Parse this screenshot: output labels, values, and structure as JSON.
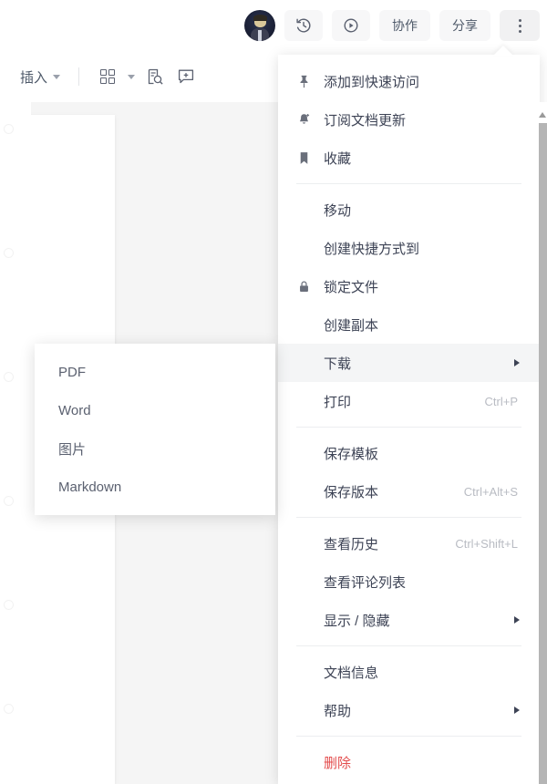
{
  "topbar": {
    "avatar_name": "user-avatar",
    "buttons": [
      {
        "name": "history-icon",
        "label": "",
        "type": "icon"
      },
      {
        "name": "play-icon",
        "label": "",
        "type": "icon"
      },
      {
        "name": "collaborate",
        "label": "协作",
        "type": "text"
      },
      {
        "name": "share",
        "label": "分享",
        "type": "text"
      },
      {
        "name": "more-options",
        "label": "",
        "type": "dots"
      }
    ]
  },
  "toolbar": {
    "insert_label": "插入",
    "grid_name": "grid-icon",
    "find_name": "find-replace-icon",
    "comment_name": "add-comment-icon"
  },
  "menu": {
    "items": [
      {
        "type": "item",
        "icon": "pin-icon",
        "label": "添加到快速访问",
        "shortcut": "",
        "arrow": false,
        "active": false,
        "danger": false
      },
      {
        "type": "item",
        "icon": "bell-add-icon",
        "label": "订阅文档更新",
        "shortcut": "",
        "arrow": false,
        "active": false,
        "danger": false
      },
      {
        "type": "item",
        "icon": "bookmark-icon",
        "label": "收藏",
        "shortcut": "",
        "arrow": false,
        "active": false,
        "danger": false
      },
      {
        "type": "sep"
      },
      {
        "type": "item",
        "icon": "",
        "label": "移动",
        "shortcut": "",
        "arrow": false,
        "active": false,
        "danger": false
      },
      {
        "type": "item",
        "icon": "",
        "label": "创建快捷方式到",
        "shortcut": "",
        "arrow": false,
        "active": false,
        "danger": false
      },
      {
        "type": "item",
        "icon": "lock-icon",
        "label": "锁定文件",
        "shortcut": "",
        "arrow": false,
        "active": false,
        "danger": false
      },
      {
        "type": "item",
        "icon": "",
        "label": "创建副本",
        "shortcut": "",
        "arrow": false,
        "active": false,
        "danger": false
      },
      {
        "type": "item",
        "icon": "",
        "label": "下载",
        "shortcut": "",
        "arrow": true,
        "active": true,
        "danger": false
      },
      {
        "type": "item",
        "icon": "",
        "label": "打印",
        "shortcut": "Ctrl+P",
        "arrow": false,
        "active": false,
        "danger": false
      },
      {
        "type": "sep"
      },
      {
        "type": "item",
        "icon": "",
        "label": "保存模板",
        "shortcut": "",
        "arrow": false,
        "active": false,
        "danger": false
      },
      {
        "type": "item",
        "icon": "",
        "label": "保存版本",
        "shortcut": "Ctrl+Alt+S",
        "arrow": false,
        "active": false,
        "danger": false
      },
      {
        "type": "sep"
      },
      {
        "type": "item",
        "icon": "",
        "label": "查看历史",
        "shortcut": "Ctrl+Shift+L",
        "arrow": false,
        "active": false,
        "danger": false
      },
      {
        "type": "item",
        "icon": "",
        "label": "查看评论列表",
        "shortcut": "",
        "arrow": false,
        "active": false,
        "danger": false
      },
      {
        "type": "item",
        "icon": "",
        "label": "显示 / 隐藏",
        "shortcut": "",
        "arrow": true,
        "active": false,
        "danger": false
      },
      {
        "type": "sep"
      },
      {
        "type": "item",
        "icon": "",
        "label": "文档信息",
        "shortcut": "",
        "arrow": false,
        "active": false,
        "danger": false
      },
      {
        "type": "item",
        "icon": "",
        "label": "帮助",
        "shortcut": "",
        "arrow": true,
        "active": false,
        "danger": false
      },
      {
        "type": "sep"
      },
      {
        "type": "item",
        "icon": "",
        "label": "删除",
        "shortcut": "",
        "arrow": false,
        "active": false,
        "danger": true
      }
    ]
  },
  "submenu": {
    "items": [
      {
        "label": "PDF"
      },
      {
        "label": "Word"
      },
      {
        "label": "图片"
      },
      {
        "label": "Markdown"
      }
    ]
  },
  "colors": {
    "accent_danger": "#e34d4d",
    "text_primary": "#3d4355",
    "text_muted": "#b9bcc3",
    "canvas": "#f5f5f5",
    "hover": "#f4f5f6"
  }
}
